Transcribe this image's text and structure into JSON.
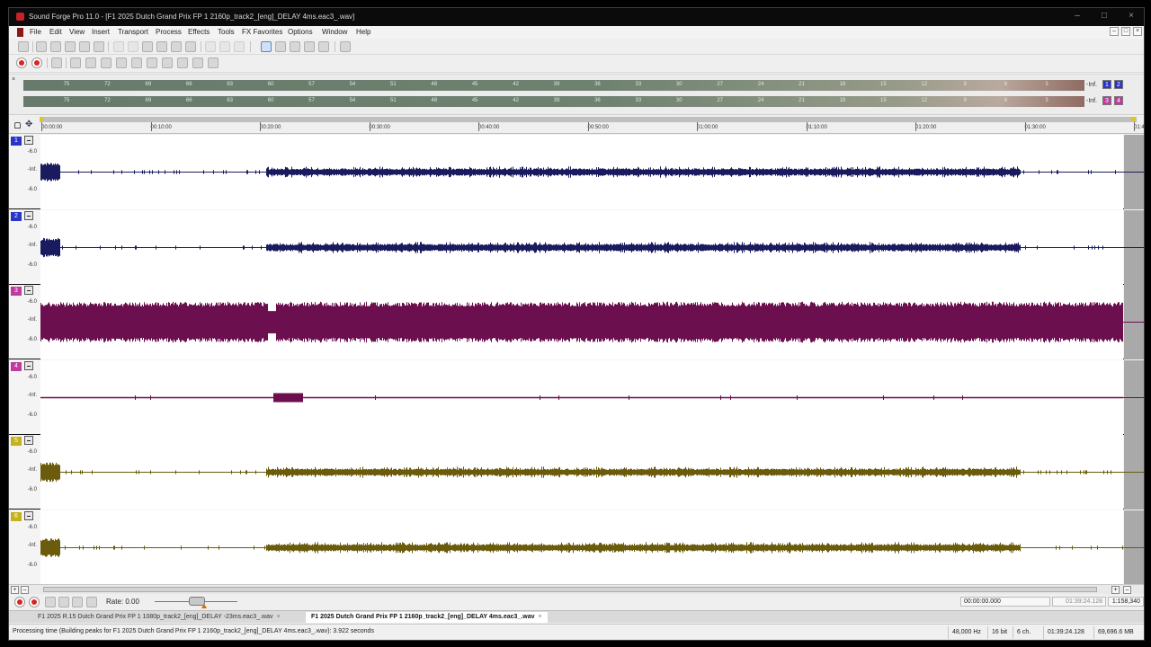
{
  "titlebar": {
    "title": "Sound Forge Pro 11.0 - [F1 2025 Dutch Grand Prix FP 1 2160p_track2_[eng]_DELAY 4ms.eac3_.wav]",
    "minimize": "–",
    "restore": "□",
    "close": "×"
  },
  "menubar": {
    "items": [
      "File",
      "Edit",
      "View",
      "Insert",
      "Transport",
      "Process",
      "Effects",
      "Tools",
      "FX Favorites",
      "Options",
      "Window",
      "Help"
    ],
    "mdi_minimize": "–",
    "mdi_restore": "□",
    "mdi_close": "×"
  },
  "meters": {
    "scale": [
      "75",
      "72",
      "69",
      "66",
      "63",
      "60",
      "57",
      "54",
      "51",
      "48",
      "45",
      "42",
      "39",
      "36",
      "33",
      "30",
      "27",
      "24",
      "21",
      "18",
      "15",
      "12",
      "9",
      "6",
      "3"
    ],
    "inf_label": "-Inf.",
    "chips_top": [
      "1",
      "2"
    ],
    "chips_bottom": [
      "3",
      "4"
    ],
    "close_glyph": "×"
  },
  "ruler": {
    "ticks": [
      "00:00:00",
      "00:10:00",
      "00:20:00",
      "00:30:00",
      "00:40:00",
      "00:50:00",
      "01:00:00",
      "01:10:00",
      "01:20:00",
      "01:30:00",
      "01:4"
    ]
  },
  "tracks": [
    {
      "num": "1",
      "labels": [
        "-6.0",
        "-Inf.",
        "-6.0"
      ],
      "color": "#1a1a5e",
      "accent": "#2a35c8"
    },
    {
      "num": "2",
      "labels": [
        "-6.0",
        "-Inf.",
        "-6.0"
      ],
      "color": "#1a1a5e",
      "accent": "#2a35c8"
    },
    {
      "num": "3",
      "labels": [
        "-6.0",
        "-Inf.",
        "-6.0"
      ],
      "color": "#6b0f4e",
      "accent": "#c03aa0"
    },
    {
      "num": "4",
      "labels": [
        "-6.0",
        "-Inf.",
        "-6.0"
      ],
      "color": "#6b0f4e",
      "accent": "#c03aa0"
    },
    {
      "num": "5",
      "labels": [
        "-6.0",
        "-Inf.",
        "-6.0"
      ],
      "color": "#6a5c0c",
      "accent": "#c4b21a"
    },
    {
      "num": "6",
      "labels": [
        "-6.0",
        "-Inf.",
        "-6.0"
      ],
      "color": "#6a5c0c",
      "accent": "#c4b21a"
    }
  ],
  "hscroll": {
    "left_plus": "+",
    "left_minus": "–",
    "right_plus": "+",
    "right_minus": "–"
  },
  "transport": {
    "rate_label": "Rate: 0.00",
    "position": "00:00:00.000",
    "length": "01:39:24.128",
    "zoom": "1:158,340"
  },
  "doctabs": [
    {
      "label": "F1 2025 R.15 Dutch Grand Prix FP 1 1080p_track2_[eng]_DELAY -23ms.eac3_.wav",
      "active": false
    },
    {
      "label": "F1 2025 Dutch Grand Prix FP 1 2160p_track2_[eng]_DELAY 4ms.eac3_.wav",
      "active": true
    }
  ],
  "statusbar": {
    "message": "Processing time (Building peaks for F1 2025 Dutch Grand Prix FP 1 2160p_track2_[eng]_DELAY 4ms.eac3_.wav): 3.922 seconds",
    "sample_rate": "48,000 Hz",
    "bit_depth": "16 bit",
    "channels": "6 ch.",
    "duration": "01:39:24.128",
    "disk_space": "69,696.6 MB"
  }
}
